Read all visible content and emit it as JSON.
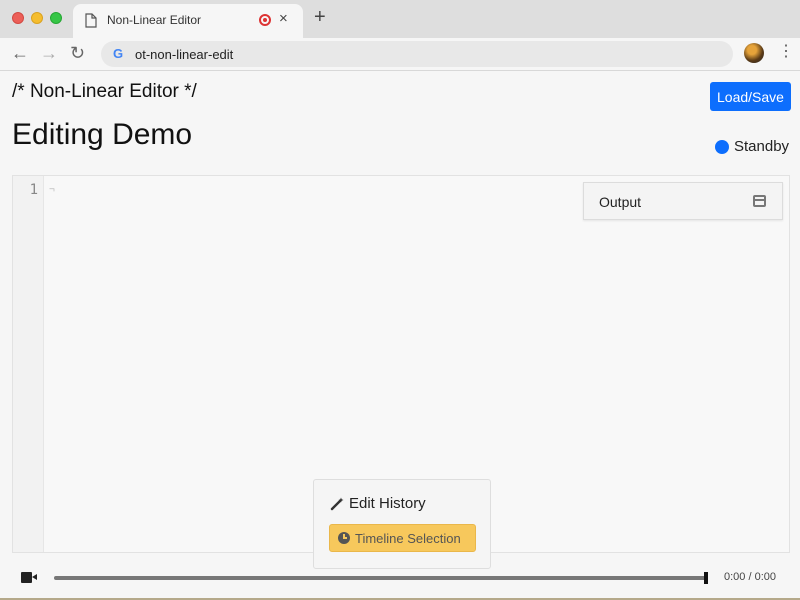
{
  "browser": {
    "tab_title": "Non-Linear Editor",
    "tab_close": "×",
    "new_tab": "+",
    "url": "ot-non-linear-edit",
    "nav_back": "←",
    "nav_forward": "→",
    "nav_reload": "↻",
    "google_icon": "G",
    "menu": "⋮"
  },
  "page": {
    "heading": "/* Non-Linear Editor */",
    "load_save_label": "Load/Save",
    "title": "Editing Demo",
    "status_label": "Standby",
    "status_color": "#0d6efd"
  },
  "editor": {
    "line_numbers": [
      "1"
    ],
    "cursor_mark": "¬",
    "output_label": "Output"
  },
  "history": {
    "title": "Edit History",
    "timeline_label": "Timeline Selection",
    "accent_color": "#f7c85c"
  },
  "player": {
    "time": "0:00 / 0:00",
    "progress": 1.0
  },
  "icons": {
    "document": "document-icon",
    "record": "record-icon",
    "wand": "magic-wand-icon",
    "clock": "clock-icon",
    "camera": "video-camera-icon",
    "output": "window-icon"
  }
}
